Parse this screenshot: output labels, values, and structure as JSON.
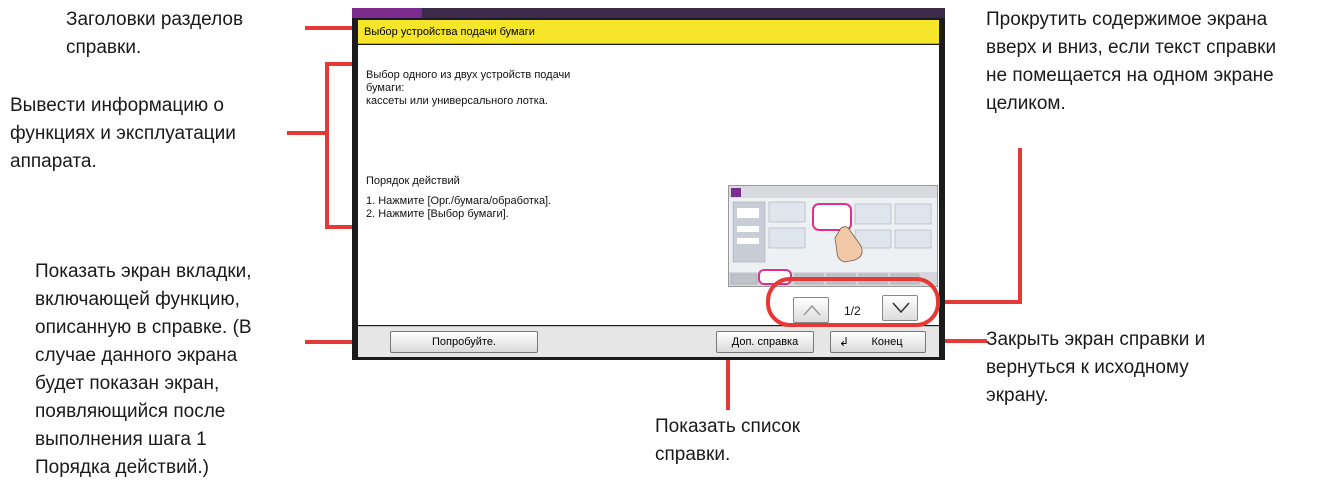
{
  "callouts": {
    "headings": "Заголовки разделов\nсправки.",
    "info": "Вывести информацию о\nфункциях и эксплуатации\nаппарата.",
    "try_it": "Показать экран вкладки,\nвключающей функцию,\nописанную в справке. (В\nслучае данного экрана\nбудет показан экран,\nпоявляющийся после\nвыполнения шага 1\nПорядка действий.)",
    "scroll": "Прокрутить содержимое экрана\nвверх и вниз, если текст справки\nне помещается на одном экране\nцеликом.",
    "close": "Закрыть экран справки и\nвернуться к исходному\nэкрану.",
    "list": "Показать список\nсправки."
  },
  "screen": {
    "title": "Выбор устройства подачи бумаги",
    "paragraph": "Выбор одного из двух устройств подачи\nбумаги:\nкассеты или универсального лотка.",
    "steps_title": "Порядок действий",
    "steps": [
      "1. Нажмите [Орг./бумага/обработка].",
      "2. Нажмите [Выбор бумаги]."
    ],
    "page_indicator": "1/2",
    "buttons": {
      "try_it": "Попробуйте.",
      "help_list": "Доп. справка",
      "end": "Конец"
    }
  },
  "colors": {
    "accent_red": "#e53935",
    "title_yellow": "#f5e629"
  }
}
